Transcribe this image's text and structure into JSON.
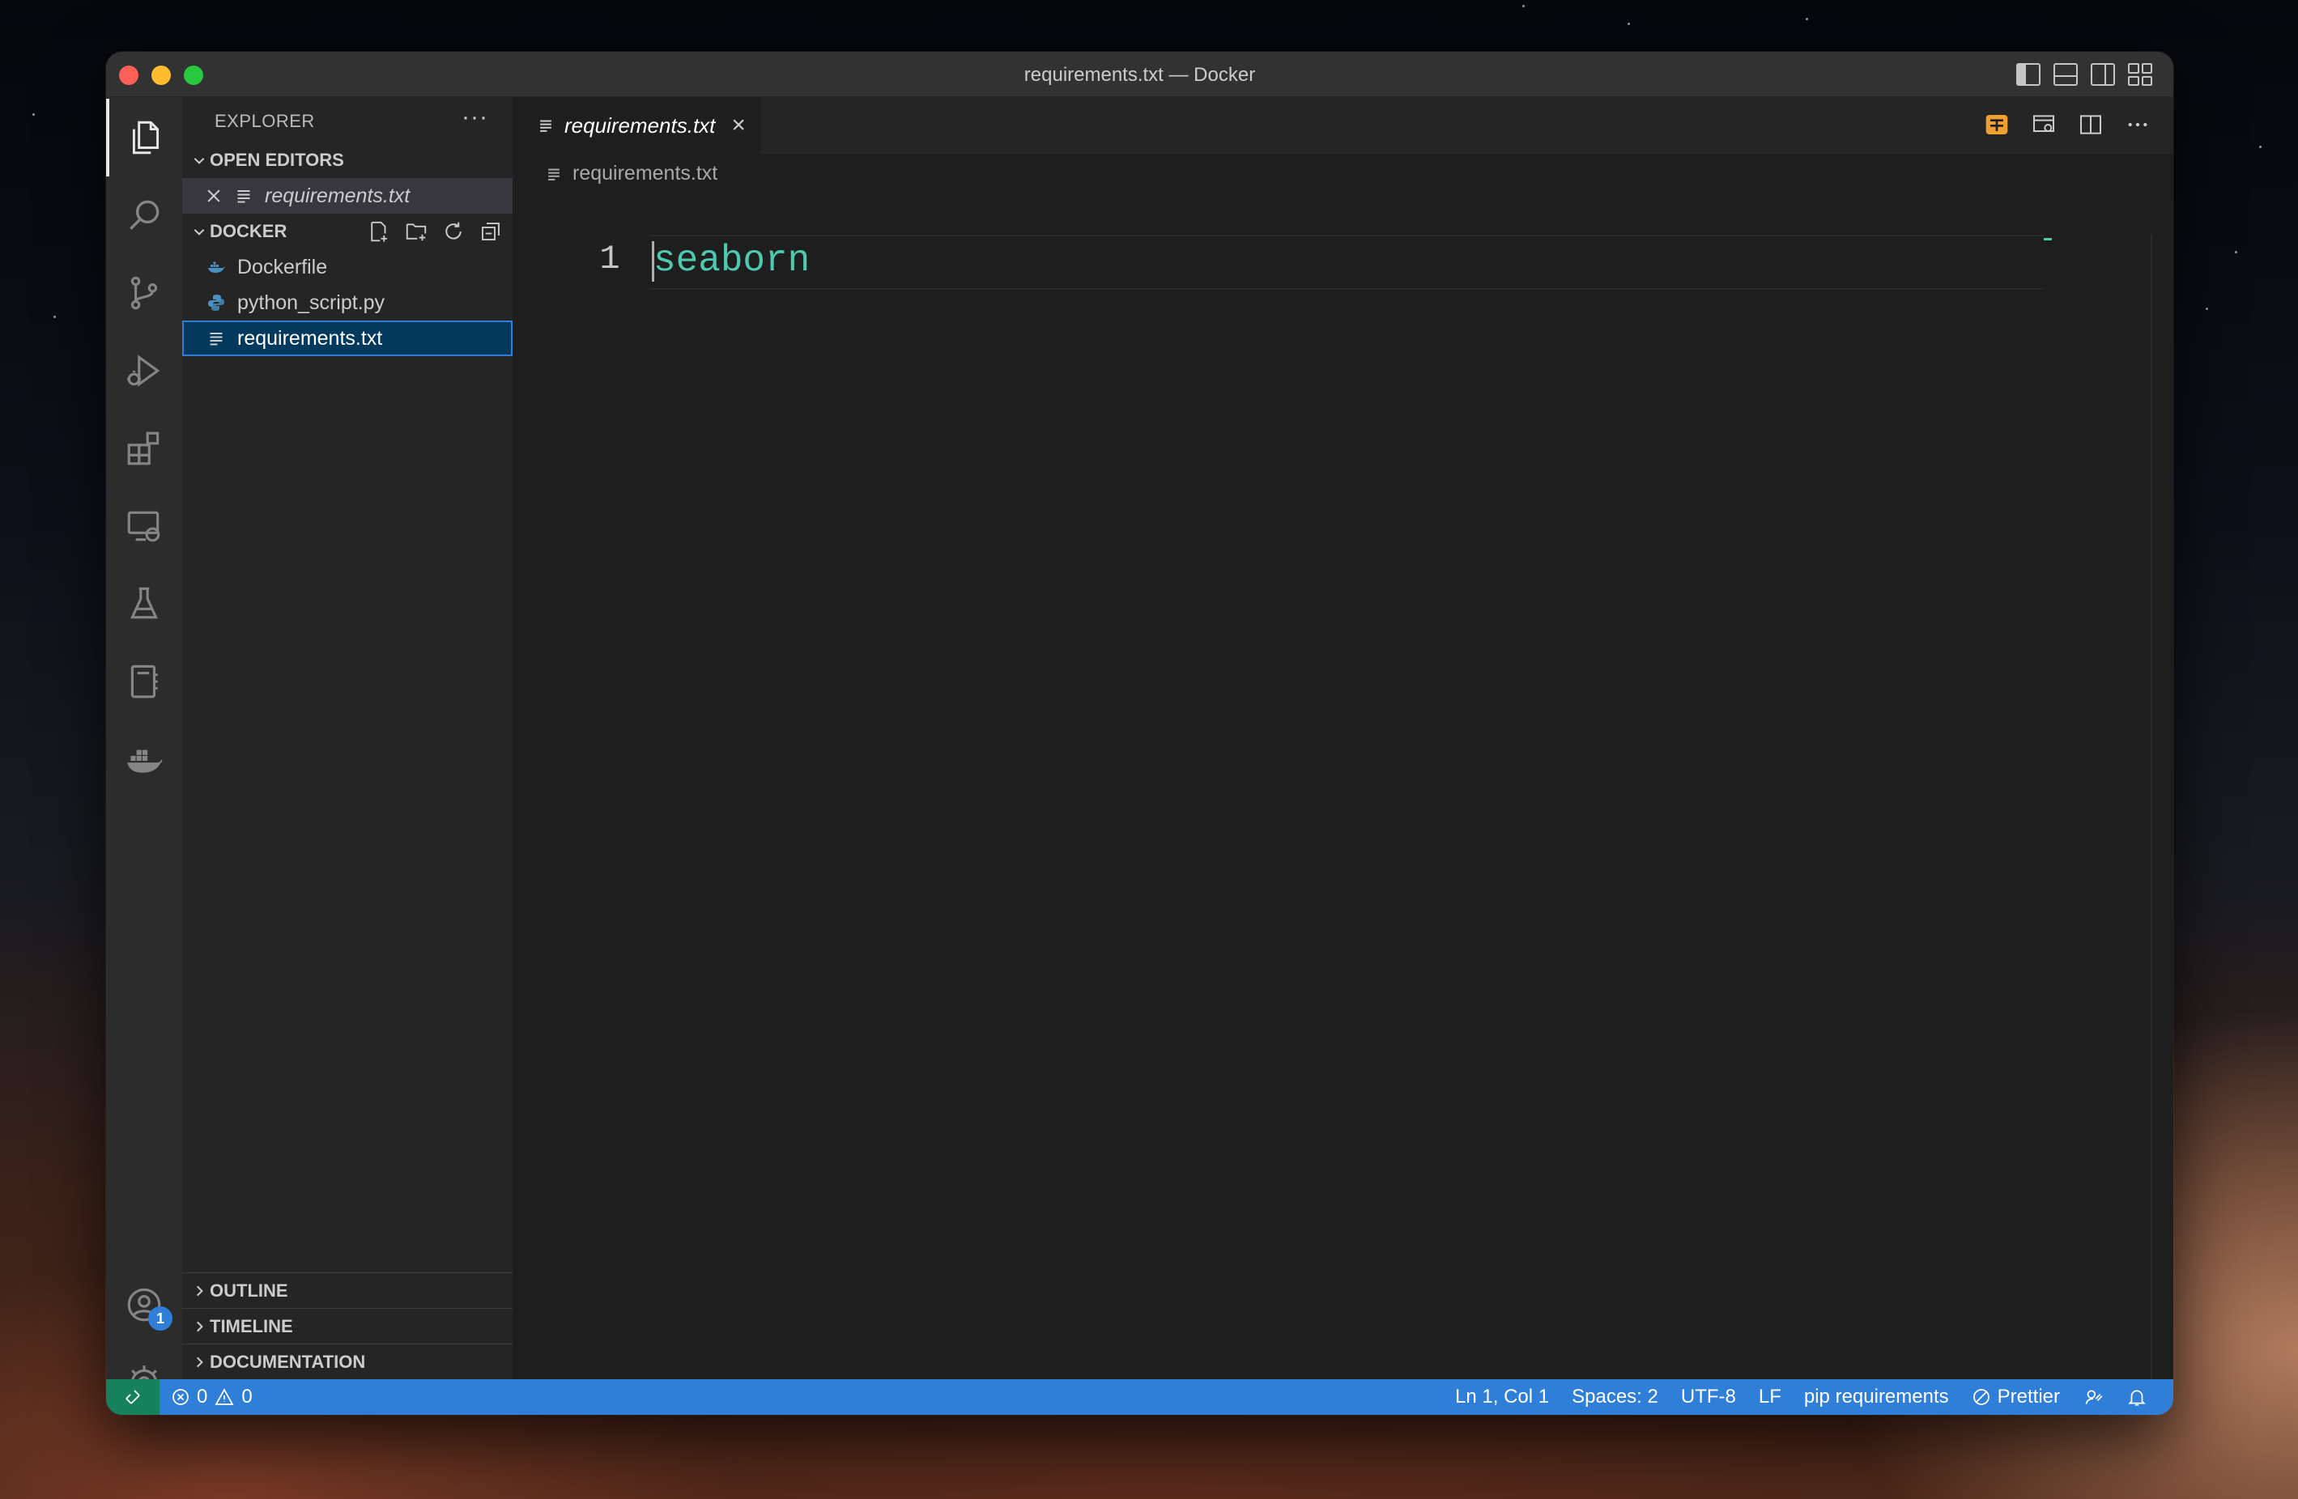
{
  "window": {
    "title": "requirements.txt — Docker"
  },
  "activity_bar": {
    "items": [
      "explorer-icon",
      "search-icon",
      "source-control-icon",
      "run-debug-icon",
      "extensions-icon",
      "remote-explorer-icon",
      "testing-icon",
      "notebook-icon",
      "docker-icon"
    ],
    "accounts_badge": "1"
  },
  "sidebar": {
    "title": "EXPLORER",
    "more": "···",
    "open_editors": {
      "label": "OPEN EDITORS",
      "items": [
        {
          "name": "requirements.txt"
        }
      ]
    },
    "folder": {
      "label": "DOCKER",
      "files": [
        {
          "name": "Dockerfile",
          "icon": "docker-file-icon"
        },
        {
          "name": "python_script.py",
          "icon": "python-file-icon"
        },
        {
          "name": "requirements.txt",
          "icon": "text-file-icon"
        }
      ]
    },
    "bottom_sections": [
      "OUTLINE",
      "TIMELINE",
      "DOCUMENTATION"
    ]
  },
  "editor": {
    "tab": {
      "label": "requirements.txt",
      "close": "×"
    },
    "breadcrumb": "requirements.txt",
    "lines": [
      {
        "number": "1",
        "text": "seaborn"
      }
    ]
  },
  "statusbar": {
    "errors": "0",
    "warnings": "0",
    "position": "Ln 1, Col 1",
    "spaces": "Spaces: 2",
    "encoding": "UTF-8",
    "eol": "LF",
    "language": "pip requirements",
    "formatter": "Prettier"
  },
  "colors": {
    "accent": "#2f7ed8",
    "remote": "#16825d",
    "code_text": "#4ec9b0"
  }
}
